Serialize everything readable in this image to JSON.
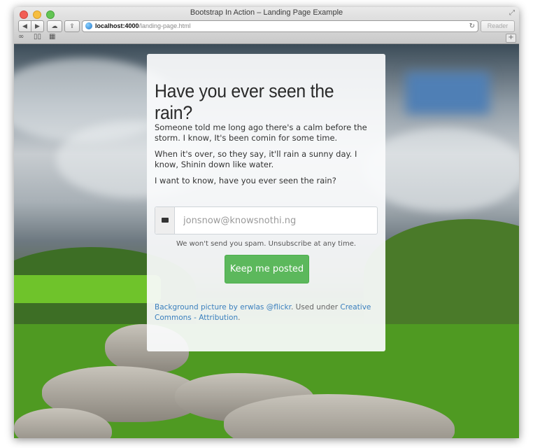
{
  "browser": {
    "title": "Bootstrap In Action – Landing Page Example",
    "url_host": "localhost:4000",
    "url_path": "/landing-page.html",
    "reader_label": "Reader",
    "reload_icon": "reload-icon",
    "back_icon": "back-arrow-icon",
    "forward_icon": "forward-arrow-icon"
  },
  "card": {
    "heading": "Have you ever seen the rain?",
    "paragraphs": [
      "Someone told me long ago there's a calm before the storm. I know, It's been comin for some time.",
      "When it's over, so they say, it'll rain a sunny day. I know, Shinin down like water.",
      "I want to know, have you ever seen the rain?"
    ],
    "email_placeholder": "jonsnow@knowsnothi.ng",
    "spam_note": "We won't send you spam. Unsubscribe at any time.",
    "cta_label": "Keep me posted",
    "credit": {
      "link1": "Background picture by erwlas @flickr",
      "middle": ". Used under ",
      "link2": "Creative Commons - Attribution",
      "end": "."
    }
  },
  "colors": {
    "cta": "#5cb85c",
    "link": "#3a7fbd"
  }
}
